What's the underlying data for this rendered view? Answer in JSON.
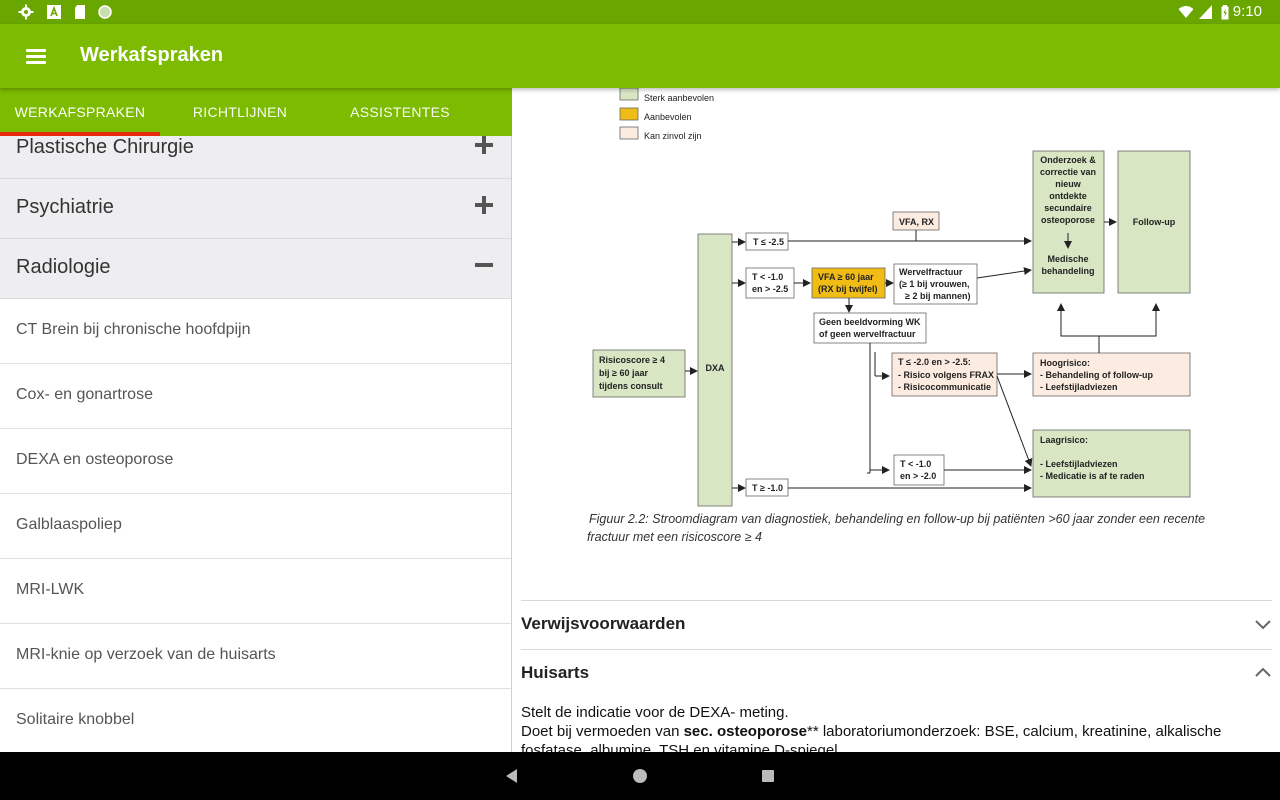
{
  "status_bar": {
    "time": "9:10",
    "left_icons": [
      "settings-icon",
      "text-a-icon",
      "sd-card-icon",
      "circle-icon"
    ],
    "right_icons": [
      "wifi-icon",
      "signal-icon",
      "battery-icon"
    ]
  },
  "app_bar": {
    "menu_icon": "hamburger-icon",
    "title": "Werkafspraken"
  },
  "tabs": [
    {
      "label": "WERKAFSPRAKEN",
      "selected": true
    },
    {
      "label": "RICHTLIJNEN",
      "selected": false
    },
    {
      "label": "ASSISTENTES",
      "selected": false
    }
  ],
  "colors": {
    "primary": "#7cbb00",
    "status": "#6aa600",
    "indicator": "#e8290b"
  },
  "categories": [
    {
      "label": "Plastische Chirurgie",
      "state": "collapsed"
    },
    {
      "label": "Psychiatrie",
      "state": "collapsed"
    },
    {
      "label": "Radiologie",
      "state": "expanded"
    }
  ],
  "items": [
    {
      "label": "CT Brein bij chronische hoofdpijn"
    },
    {
      "label": "Cox- en gonartrose"
    },
    {
      "label": "DEXA en osteoporose"
    },
    {
      "label": "Galblaaspoliep"
    },
    {
      "label": "MRI-LWK"
    },
    {
      "label": "MRI-knie op verzoek van de huisarts"
    },
    {
      "label": "Solitaire knobbel"
    }
  ],
  "figure": {
    "legend": [
      "Sterk aanbevolen",
      "Aanbevolen",
      "Kan zinvol zijn"
    ],
    "risk_lines": [
      "Risicoscore ≥ 4",
      "bij ≥ 60 jaar",
      "tijdens consult"
    ],
    "dxa": "DXA",
    "t_le_25": "T ≤ -2.5",
    "t_mid": [
      "T < -1.0",
      "en > -2.5"
    ],
    "t_ge_10": "T ≥ -1.0",
    "vfa_rx": "VFA, RX",
    "vfa60": [
      "VFA ≥ 60 jaar",
      "(RX bij twijfel)"
    ],
    "wervelfractuur": [
      "Wervelfractuur",
      "(≥ 1 bij vrouwen,",
      "≥ 2 bij mannen)"
    ],
    "geen": [
      "Geen beeldvorming WK",
      "of geen wervelfractuur"
    ],
    "frax": [
      "T ≤ -2.0 en > -2.5:",
      "- Risico volgens FRAX",
      "- Risicocommunicatie"
    ],
    "t_low": [
      "T < -1.0",
      "en > -2.0"
    ],
    "onderzoek": [
      "Onderzoek &",
      "correctie van",
      "nieuw",
      "ontdekte",
      "secundaire",
      "osteoporose"
    ],
    "medische": [
      "Medische",
      "behandeling"
    ],
    "followup": "Follow-up",
    "hoogrisico": [
      "Hoogrisico:",
      "- Behandeling of follow-up",
      "- Leefstijladviezen"
    ],
    "laagrisico": [
      "Laagrisico:",
      "- Leefstijladviezen",
      "- Medicatie is af te raden"
    ],
    "caption_lines": [
      "Figuur 2.2: Stroomdiagram van diagnostiek, behandeling en follow-up bij patiënten >60 jaar zonder een recente",
      "fractuur met een risicoscore ≥ 4"
    ]
  },
  "sections": [
    {
      "label": "Verwijsvoorwaarden",
      "state": "collapsed"
    },
    {
      "label": "Huisarts",
      "state": "expanded"
    }
  ],
  "huisarts": {
    "line1": "Stelt de indicatie voor de DEXA- meting.",
    "line2_pre": "Doet bij vermoeden van ",
    "line2_bold": "sec. osteoporose",
    "line2_post": "** laboratoriumonderzoek: BSE, calcium, kreatinine, alkalische",
    "line3": "fosfatase, albumine, TSH en vitamine D-spiegel"
  },
  "nav_bar": [
    "back-icon",
    "home-icon",
    "recents-icon"
  ]
}
